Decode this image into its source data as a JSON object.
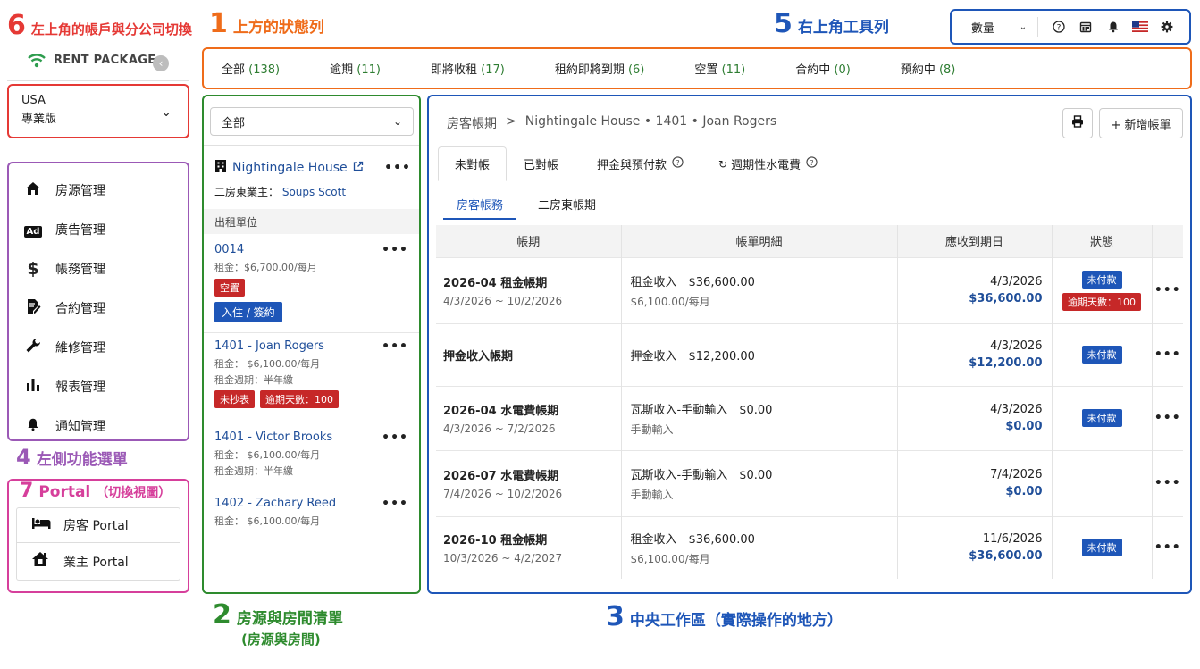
{
  "annotations": {
    "a6": {
      "num": "6",
      "text": "左上角的帳戶與分公司切換"
    },
    "a1": {
      "num": "1",
      "text": "上方的狀態列"
    },
    "a5": {
      "num": "5",
      "text": "右上角工具列"
    },
    "a4": {
      "num": "4",
      "text": "左側功能選單"
    },
    "a7": {
      "num": "7",
      "text": "Portal",
      "sub": "（切換視圖）"
    },
    "a2": {
      "num": "2",
      "text": "房源與房間清單",
      "sub": "(房源與房間)"
    },
    "a3": {
      "num": "3",
      "text": "中央工作區（實際操作的地方）"
    }
  },
  "colors": {
    "red": "#e53935",
    "orange": "#ef6c1a",
    "green": "#2e8b2e",
    "blue": "#1e56b8",
    "purple": "#9b59b6",
    "pink": "#d63f9b"
  },
  "toolbar": {
    "select_value": "數量",
    "icons": [
      "help-icon",
      "calendar-icon",
      "bell-icon",
      "us-flag-icon",
      "gear-icon"
    ]
  },
  "status_tabs": [
    {
      "label": "全部",
      "count": "(138)"
    },
    {
      "label": "逾期",
      "count": "(11)"
    },
    {
      "label": "即將收租",
      "count": "(17)"
    },
    {
      "label": "租約即將到期",
      "count": "(6)"
    },
    {
      "label": "空置",
      "count": "(11)"
    },
    {
      "label": "合約中",
      "count": "(0)"
    },
    {
      "label": "預約中",
      "count": "(8)"
    }
  ],
  "account": {
    "logo": "RENT PACKAGE",
    "region": "USA",
    "plan": "專業版"
  },
  "nav": {
    "items": [
      "房源管理",
      "廣告管理",
      "帳務管理",
      "合約管理",
      "維修管理",
      "報表管理",
      "通知管理"
    ],
    "ad_badge": "Ad"
  },
  "portal": {
    "items": [
      "房客 Portal",
      "業主 Portal"
    ]
  },
  "plist": {
    "filter": "全部",
    "property": "Nightingale House",
    "landlord_label": "二房東業主：",
    "landlord_name": "Soups Scott",
    "section": "出租單位",
    "units": [
      {
        "name": "0014",
        "rent": "租金：$6,700.00/每月",
        "tag1": "空置",
        "tag2": "入住 / 簽約"
      },
      {
        "name": "1401 - Joan Rogers",
        "rent": "租金： $6,100.00/每月",
        "cycle": "租金週期：半年繳",
        "tag1": "未抄表",
        "tag2": "逾期天數：100"
      },
      {
        "name": "1401 - Victor Brooks",
        "rent": "租金： $6,100.00/每月",
        "cycle": "租金週期：半年繳"
      },
      {
        "name": "1402 - Zachary Reed",
        "rent": "租金： $6,100.00/每月"
      }
    ]
  },
  "main": {
    "breadcrumb": {
      "root": "房客帳期",
      "sep": ">",
      "path": "Nightingale House • 1401 • Joan Rogers"
    },
    "print_icon": "printer-icon",
    "add_label": "+ 新增帳單",
    "tabs": [
      "未對帳",
      "已對帳",
      "押金與預付款",
      "週期性水電費"
    ],
    "subtabs": [
      "房客帳務",
      "二房東帳期"
    ],
    "headers": [
      "帳期",
      "帳單明細",
      "應收到期日",
      "狀態"
    ],
    "rows": [
      {
        "period": "2026-04 租金帳期",
        "range": "4/3/2026 ~ 10/2/2026",
        "detail": "租金收入　$36,600.00",
        "detail_sub": "$6,100.00/每月",
        "due": "4/3/2026",
        "amount": "$36,600.00",
        "status": "未付款",
        "overdue": "逾期天數：100"
      },
      {
        "period": "押金收入帳期",
        "range": "",
        "detail": "押金收入　$12,200.00",
        "detail_sub": "",
        "due": "4/3/2026",
        "amount": "$12,200.00",
        "status": "未付款",
        "overdue": ""
      },
      {
        "period": "2026-04 水電費帳期",
        "range": "4/3/2026 ~ 7/2/2026",
        "detail": "瓦斯收入-手動輸入　$0.00",
        "detail_sub": "手動輸入",
        "due": "4/3/2026",
        "amount": "$0.00",
        "status": "未付款",
        "overdue": ""
      },
      {
        "period": "2026-07 水電費帳期",
        "range": "7/4/2026 ~ 10/2/2026",
        "detail": "瓦斯收入-手動輸入　$0.00",
        "detail_sub": "手動輸入",
        "due": "7/4/2026",
        "amount": "$0.00",
        "status": "",
        "overdue": ""
      },
      {
        "period": "2026-10 租金帳期",
        "range": "10/3/2026 ~ 4/2/2027",
        "detail": "租金收入　$36,600.00",
        "detail_sub": "$6,100.00/每月",
        "due": "11/6/2026",
        "amount": "$36,600.00",
        "status": "未付款",
        "overdue": ""
      }
    ]
  }
}
